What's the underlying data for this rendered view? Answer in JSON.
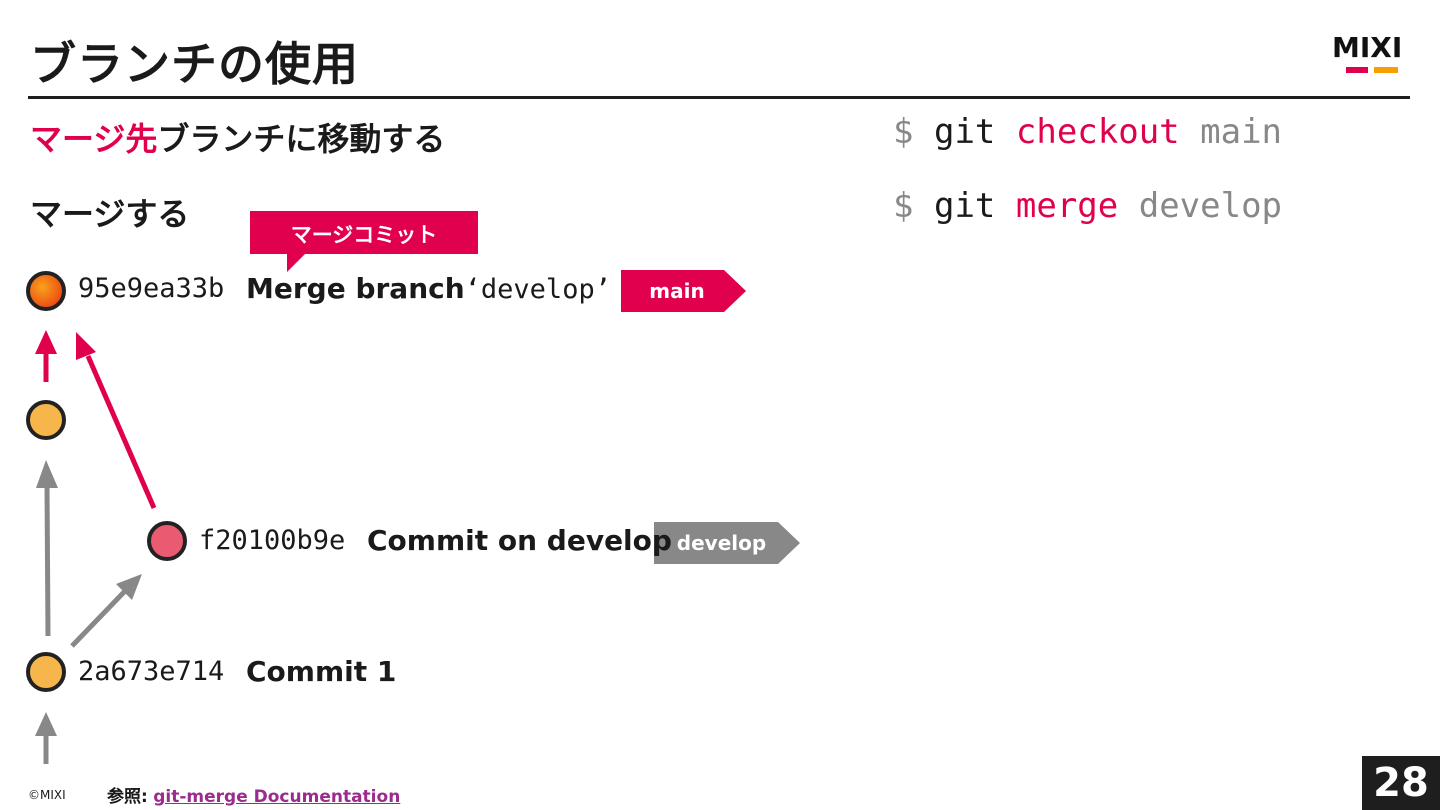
{
  "slide": {
    "title": "ブランチの使用",
    "page_number": "28",
    "logo_text": "MIXI",
    "colors": {
      "accent": "#e0004d",
      "gray": "#888888",
      "logo_orange": "#f5a000"
    }
  },
  "steps": {
    "step1_accent": "マージ先",
    "step1_rest": "ブランチに移動する",
    "step2": "マージする"
  },
  "commands": [
    {
      "prompt": "$",
      "git": "git",
      "verb": "checkout",
      "arg": "main"
    },
    {
      "prompt": "$",
      "git": "git",
      "verb": "merge",
      "arg": "develop"
    }
  ],
  "callout": {
    "label": "マージコミット"
  },
  "commits": [
    {
      "hash": "95e9ea33b",
      "message": "Merge branch",
      "quoted": "‘develop’",
      "node_color": "#f06a1a"
    },
    {
      "hash": "",
      "message": "",
      "node_color": "#f7b64c"
    },
    {
      "hash": "f20100b9e",
      "message": "Commit on develop",
      "node_color": "#ea5b72"
    },
    {
      "hash": "2a673e714",
      "message": "Commit 1",
      "node_color": "#f7b64c"
    }
  ],
  "tags": {
    "main": {
      "label": "main",
      "color": "#e0004d"
    },
    "develop": {
      "label": "develop",
      "color": "#888888"
    }
  },
  "footer": {
    "copyright": "©MIXI",
    "ref_label": "参照:",
    "ref_link": "git-merge Documentation"
  }
}
